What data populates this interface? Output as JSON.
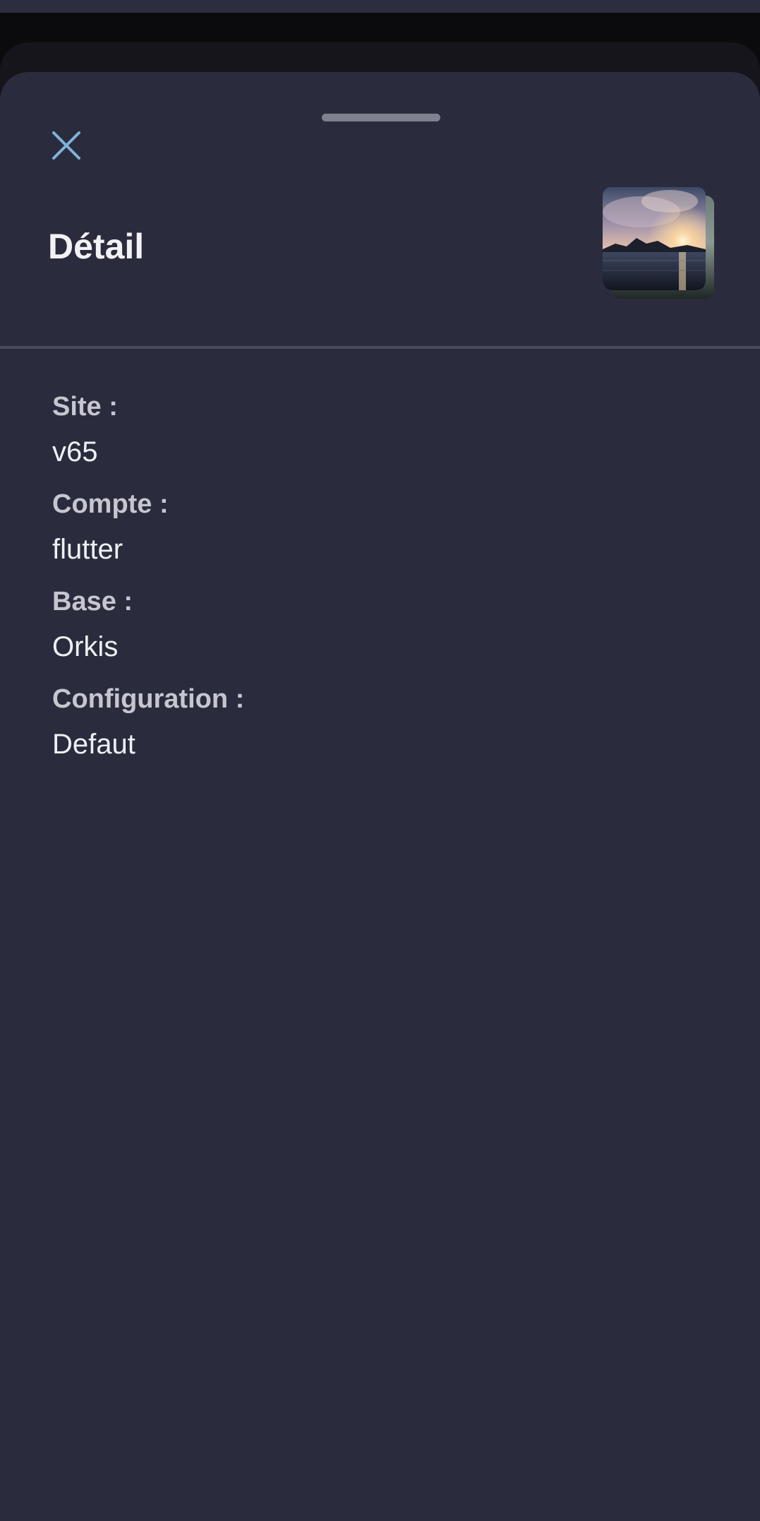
{
  "sheet": {
    "title": "Détail"
  },
  "icons": {
    "close": "close-icon",
    "thumbnail": "landscape-sunset-image"
  },
  "details": [
    {
      "label": "Site :",
      "value": "v65"
    },
    {
      "label": "Compte :",
      "value": "flutter"
    },
    {
      "label": "Base :",
      "value": "Orkis"
    },
    {
      "label": "Configuration :",
      "value": "Defaut"
    }
  ],
  "colors": {
    "background": "#2a2c3d",
    "accent": "#7fb3d9",
    "title": "#f2f2f5",
    "label": "#c5c6d0",
    "value": "#eef0f5",
    "divider": "#4a4c5c"
  }
}
